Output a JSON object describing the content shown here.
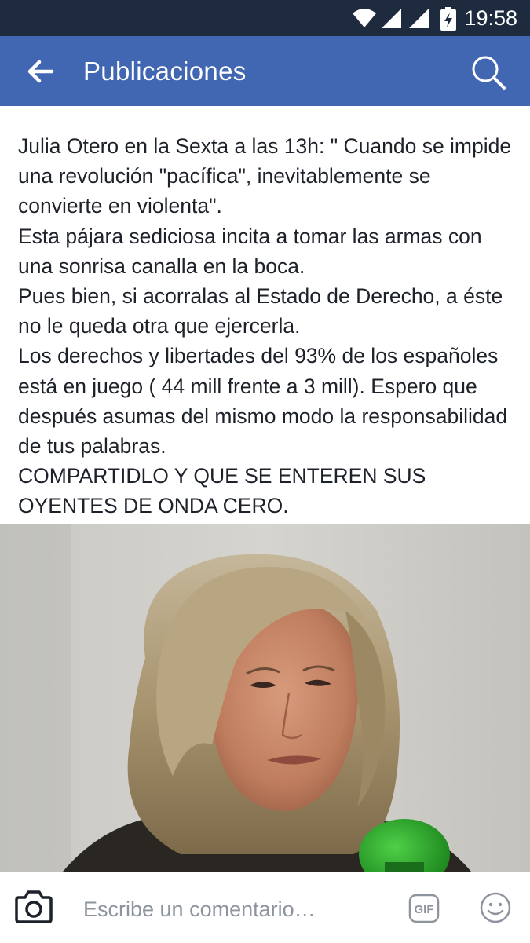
{
  "status_bar": {
    "time": "19:58",
    "icons": [
      "wifi-icon",
      "signal-icon",
      "signal-icon",
      "battery-charging-icon"
    ]
  },
  "header": {
    "title": "Publicaciones",
    "back_icon": "arrow-left-icon",
    "search_icon": "search-icon",
    "background": "#4267b2"
  },
  "post": {
    "paragraphs": [
      "Julia Otero en la Sexta a las 13h: \" Cuando se impide una revolución \"pacífica\", inevitablemente se convierte en violenta\".",
      "Esta pájara sediciosa incita a tomar las armas con una sonrisa canalla en la boca.",
      "Pues bien, si acorralas al Estado de Derecho, a éste no le queda otra que ejercerla.",
      "Los derechos y libertades del 93% de los españoles está en juego ( 44 mill frente a 3 mill). Espero que después asumas del mismo modo la responsabilidad de tus palabras.",
      "COMPARTIDLO Y QUE SE ENTEREN SUS OYENTES DE ONDA CERO."
    ]
  },
  "comment_bar": {
    "placeholder": "Escribe un comentario…",
    "camera_icon": "camera-icon",
    "gif_label": "GIF",
    "emoji_icon": "smiley-icon"
  }
}
